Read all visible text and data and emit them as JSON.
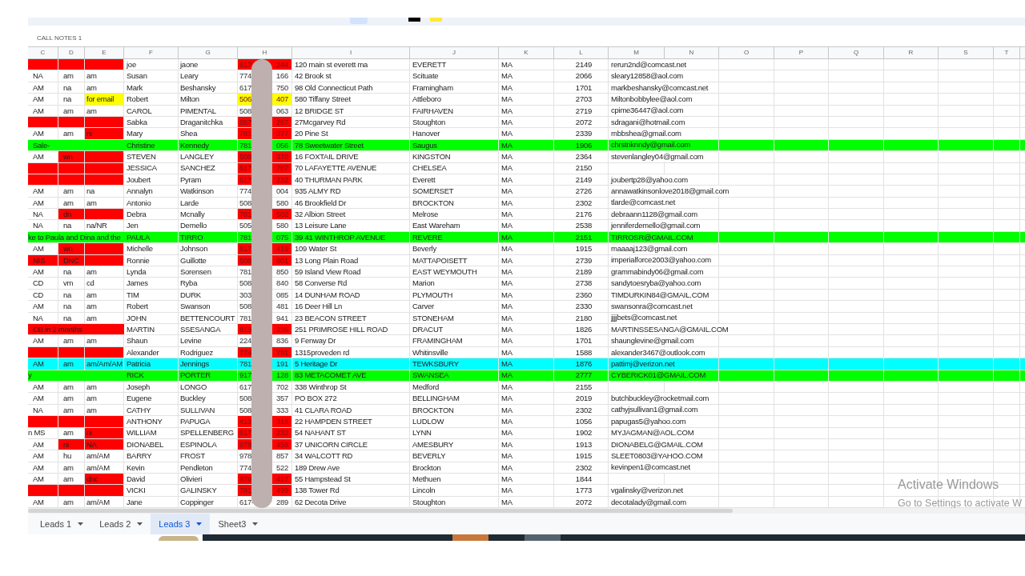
{
  "formula_bar": {
    "cell_text": "CALL NOTES 1"
  },
  "toolbar": {
    "swatches": [
      {
        "color": "#000000"
      },
      {
        "color": "#ffe83a"
      }
    ]
  },
  "columns": [
    "C",
    "D",
    "E",
    "F",
    "G",
    "H",
    "I",
    "J",
    "K",
    "L",
    "M",
    "N",
    "O",
    "P",
    "Q",
    "R",
    "S",
    "T"
  ],
  "rows": [
    {
      "notes": [
        {
          "color": "#ff0000"
        },
        {
          "color": "#ff0000"
        },
        {
          "color": "#ff0000"
        }
      ],
      "first": "joe",
      "last": "jaone",
      "phone": {
        "start": "617",
        "end": "244",
        "color": "#ff0000"
      },
      "address": "120 main st everett ma",
      "city": "EVERETT",
      "state": "MA",
      "zip": "2149",
      "email": "rerun2nd@comcast.net"
    },
    {
      "notes": [
        {
          "text": "NA"
        },
        {
          "text": "am"
        },
        {
          "text": "am"
        }
      ],
      "first": "Susan",
      "last": "Leary",
      "phone": {
        "start": "774",
        "end": "166"
      },
      "address": "42 Brook st",
      "city": "Scituate",
      "state": "MA",
      "zip": "2066",
      "email": "sleary12858@aol.com"
    },
    {
      "notes": [
        {
          "text": "AM"
        },
        {
          "text": "na"
        },
        {
          "text": "am"
        }
      ],
      "first": "Mark",
      "last": "Beshansky",
      "phone": {
        "start": "617",
        "end": "750"
      },
      "address": "98 Old Connecticut Path",
      "city": "Framingham",
      "state": "MA",
      "zip": "1701",
      "email": "markbeshansky@comcast.net"
    },
    {
      "notes": [
        {
          "text": "AM"
        },
        {
          "text": "na"
        },
        {
          "text": "for email",
          "color": "#ffff00"
        }
      ],
      "first": "Robert",
      "last": "Milton",
      "phone": {
        "start": "506",
        "end": "407",
        "color": "#ffff00"
      },
      "address": "580 Tiffany Street",
      "city": "Attleboro",
      "state": "MA",
      "zip": "2703",
      "email": "Miltonbobbylee@aol.com"
    },
    {
      "notes": [
        {
          "text": "AM"
        },
        {
          "text": "am"
        },
        {
          "text": "am"
        }
      ],
      "first": "CAROL",
      "last": "PIMENTAL",
      "phone": {
        "start": "508",
        "end": "063"
      },
      "address": "12 BRIDGE ST",
      "city": "FAIRHAVEN",
      "state": "MA",
      "zip": "2719",
      "email": "cpime36447@aol.com"
    },
    {
      "notes": [
        {
          "color": "#ff0000"
        },
        {
          "color": "#ff0000"
        },
        {
          "color": "#ff0000"
        }
      ],
      "first": "Sabka",
      "last": "Draganitchka",
      "phone": {
        "start": "857",
        "end": "267",
        "color": "#ff0000"
      },
      "address": "27Mcgarvey Rd",
      "city": "Stoughton",
      "state": "MA",
      "zip": "2072",
      "email": "sdragani@hotmail.com"
    },
    {
      "notes": [
        {
          "text": "AM"
        },
        {
          "text": "am"
        },
        {
          "text": "ni",
          "color": "#ff0000"
        }
      ],
      "first": "Mary",
      "last": "Shea",
      "phone": {
        "start": "781",
        "end": "377",
        "color": "#ff0000"
      },
      "address": "20 Pine St",
      "city": "Hanover",
      "state": "MA",
      "zip": "2339",
      "email": "mbbshea@gmail.com"
    },
    {
      "color": "#00ff00",
      "merged_note": {
        "text": "Sale-"
      },
      "first": "Christine",
      "last": "Kennedy",
      "phone": {
        "start": "781",
        "end": "056"
      },
      "address": "78 Sweetwater Street",
      "city": "Saugus",
      "state": "MA",
      "zip": "1906",
      "email": "chrstnknndy@gmail.com"
    },
    {
      "notes": [
        {
          "text": "AM"
        },
        {
          "text": "wn",
          "color": "#ff0000"
        },
        {
          "color": "#ff0000"
        }
      ],
      "first": "STEVEN",
      "last": "LANGLEY",
      "phone": {
        "start": "508",
        "end": "370",
        "color": "#ff0000"
      },
      "address": "16 FOXTAIL DRIVE",
      "city": "KINGSTON",
      "state": "MA",
      "zip": "2364",
      "email": "stevenlangley04@gmail.com"
    },
    {
      "notes": [
        {
          "color": "#ff0000"
        },
        {
          "color": "#ff0000"
        },
        {
          "color": "#ff0000"
        }
      ],
      "first": "JESSICA",
      "last": "SANCHEZ",
      "phone": {
        "start": "617",
        "end": "787",
        "color": "#ff0000"
      },
      "address": "70 LAFAYETTE AVENUE",
      "city": "CHELSEA",
      "state": "MA",
      "zip": "2150"
    },
    {
      "notes": [
        {
          "color": "#ff0000"
        },
        {
          "color": "#ff0000"
        },
        {
          "color": "#ff0000"
        }
      ],
      "first": "Joubert",
      "last": "Pyram",
      "phone": {
        "start": "617",
        "end": "232",
        "color": "#ff0000"
      },
      "address": "40 THURMAN PARK",
      "city": "Everett",
      "state": "MA",
      "zip": "2149",
      "email": "joubertp28@yahoo.com"
    },
    {
      "notes": [
        {
          "text": "AM"
        },
        {
          "text": "am"
        },
        {
          "text": "na"
        }
      ],
      "first": "Annalyn",
      "last": "Watkinson",
      "phone": {
        "start": "774",
        "end": "004"
      },
      "address": "935 ALMY RD",
      "city": "SOMERSET",
      "state": "MA",
      "zip": "2726",
      "email": "annawatkinsonlove2018@gmail.com"
    },
    {
      "notes": [
        {
          "text": "AM"
        },
        {
          "text": "am"
        },
        {
          "text": "am"
        }
      ],
      "first": "Antonio",
      "last": "Larde",
      "phone": {
        "start": "508",
        "end": "580"
      },
      "address": "46 Brookfield Dr",
      "city": "BROCKTON",
      "state": "MA",
      "zip": "2302",
      "email": "tlarde@comcast.net"
    },
    {
      "notes": [
        {
          "text": "NA"
        },
        {
          "text": "dn",
          "color": "#ff0000"
        },
        {
          "color": "#ff0000"
        }
      ],
      "first": "Debra",
      "last": "Mcnally",
      "phone": {
        "start": "781",
        "end": "502",
        "color": "#ff0000"
      },
      "address": "32 Albion Street",
      "city": "Melrose",
      "state": "MA",
      "zip": "2176",
      "email": "debraann1128@gmail.com"
    },
    {
      "notes": [
        {
          "text": "NA"
        },
        {
          "text": "na"
        },
        {
          "text": "na/NR"
        }
      ],
      "first": "Jen",
      "last": "Demello",
      "phone": {
        "start": "505",
        "end": "580"
      },
      "address": "13 Leisure Lane",
      "city": "East Wareham",
      "state": "MA",
      "zip": "2538",
      "email": "jenniferdemello@gmail.com"
    },
    {
      "color": "#00ff00",
      "merged_note": {
        "text": "ke to Paula and Dina and the",
        "cut": true
      },
      "first": "PAULA",
      "last": "TIRRO",
      "phone": {
        "start": "781",
        "end": "075"
      },
      "address": "39  41 WINTHROP AVENUE",
      "city": "REVERE",
      "state": "MA",
      "zip": "2151",
      "email": "TIRROSR@GMAIL.COM"
    },
    {
      "notes": [
        {
          "text": "AM"
        },
        {
          "text": "wn",
          "color": "#ff0000"
        },
        {
          "color": "#ff0000"
        }
      ],
      "first": "Michelle",
      "last": "Johnson",
      "phone": {
        "start": "617",
        "end": "419",
        "color": "#ff0000"
      },
      "address": "109 Water St",
      "city": "Beverly",
      "state": "MA",
      "zip": "1915",
      "email": "maaaaj123@gmail.com"
    },
    {
      "notes": [
        {
          "text": "NIS",
          "color": "#ff0000"
        },
        {
          "text": "DNC",
          "color": "#ff0000"
        },
        {
          "color": "#ff0000"
        }
      ],
      "first": "Ronnie",
      "last": "Guillotte",
      "phone": {
        "start": "508",
        "end": "901",
        "color": "#ff0000"
      },
      "address": "13 Long Plain Road",
      "city": "MATTAPOISETT",
      "state": "MA",
      "zip": "2739",
      "email": "imperialforce2003@yahoo.com"
    },
    {
      "notes": [
        {
          "text": "AM"
        },
        {
          "text": "na"
        },
        {
          "text": "am"
        }
      ],
      "first": "Lynda",
      "last": "Sorensen",
      "phone": {
        "start": "781",
        "end": "850"
      },
      "address": "59 Island View Road",
      "city": "EAST WEYMOUTH",
      "state": "MA",
      "zip": "2189",
      "email": "grammabindy06@gmail.com"
    },
    {
      "notes": [
        {
          "text": "CD"
        },
        {
          "text": "vm"
        },
        {
          "text": "cd"
        }
      ],
      "first": "James",
      "last": "Ryba",
      "phone": {
        "start": "508",
        "end": "840"
      },
      "address": "58 Converse Rd",
      "city": "Marion",
      "state": "MA",
      "zip": "2738",
      "email": "sandytoesryba@yahoo.com"
    },
    {
      "notes": [
        {
          "text": "CD"
        },
        {
          "text": "na"
        },
        {
          "text": "am"
        }
      ],
      "first": "TIM",
      "last": "DURK",
      "phone": {
        "start": "303",
        "end": "085"
      },
      "address": "14 DUNHAM ROAD",
      "city": "PLYMOUTH",
      "state": "MA",
      "zip": "2360",
      "email": "TIMDURKIN84@GMAIL.COM"
    },
    {
      "notes": [
        {
          "text": "AM"
        },
        {
          "text": "na"
        },
        {
          "text": "am"
        }
      ],
      "first": "Robert",
      "last": "Swanson",
      "phone": {
        "start": "508",
        "end": "481"
      },
      "address": "16 Deer Hill Ln",
      "city": "Carver",
      "state": "MA",
      "zip": "2330",
      "email": "swansonra@comcast.net"
    },
    {
      "notes": [
        {
          "text": "NA"
        },
        {
          "text": "na"
        },
        {
          "text": "am"
        }
      ],
      "first": "JOHN",
      "last": "BETTENCOURT",
      "phone": {
        "start": "781",
        "end": "941"
      },
      "address": "23 BEACON STREET",
      "city": "STONEHAM",
      "state": "MA",
      "zip": "2180",
      "email": "jjjjbets@comcast.net"
    },
    {
      "merged_note": {
        "text": "CB in 2 months",
        "color": "#ff0000"
      },
      "first": "MARTIN",
      "last": "SSESANGA",
      "phone": {
        "start": "813",
        "end": "235",
        "color": "#ff0000"
      },
      "address": "251 PRIMROSE HILL ROAD",
      "city": "DRACUT",
      "state": "MA",
      "zip": "1826",
      "email": "MARTINSSESANGA@GMAIL.COM"
    },
    {
      "notes": [
        {
          "text": "AM"
        },
        {
          "text": "am"
        },
        {
          "text": "am"
        }
      ],
      "first": "Shaun",
      "last": "Levine",
      "phone": {
        "start": "224",
        "end": "836"
      },
      "address": "9 Fenway Dr",
      "city": "FRAMINGHAM",
      "state": "MA",
      "zip": "1701",
      "email": "shaunglevine@gmail.com"
    },
    {
      "notes": [
        {
          "color": "#ff0000"
        },
        {
          "color": "#ff0000"
        },
        {
          "color": "#ff0000"
        }
      ],
      "first": "Alexander",
      "last": "Rodriguez",
      "phone": {
        "start": "774",
        "end": "791",
        "color": "#ff0000"
      },
      "address": "1315proveden rd",
      "city": "Whitinsville",
      "state": "MA",
      "zip": "1588",
      "email": "alexander3467@outlook.com"
    },
    {
      "color": "#00ffff",
      "notes": [
        {
          "text": "AM"
        },
        {
          "text": "am"
        },
        {
          "text": "am/Am/AM"
        }
      ],
      "first": "Patricia",
      "last": "Jennings",
      "phone": {
        "start": "781",
        "end": "191"
      },
      "address": "5 Heritage Dr",
      "city": "TEWKSBURY",
      "state": "MA",
      "zip": "1876",
      "email": "pattimj@verizon.net"
    },
    {
      "color": "#00ff00",
      "merged_note": {
        "text": "y",
        "cut": true
      },
      "first": "RICK",
      "last": "PORTER",
      "phone": {
        "start": "917",
        "end": "128"
      },
      "address": "83 METACOMET AVE",
      "city": "SWANSEA",
      "state": "MA",
      "zip": "2777",
      "email": "CYBERICK01@GMAIL.COM"
    },
    {
      "notes": [
        {
          "text": "AM"
        },
        {
          "text": "am"
        },
        {
          "text": "am"
        }
      ],
      "first": "Joseph",
      "last": "LONGO",
      "phone": {
        "start": "617",
        "end": "702"
      },
      "address": "338 Winthrop St",
      "city": "Medford",
      "state": "MA",
      "zip": "2155"
    },
    {
      "notes": [
        {
          "text": "AM"
        },
        {
          "text": "am"
        },
        {
          "text": "am"
        }
      ],
      "first": "Eugene",
      "last": "Buckley",
      "phone": {
        "start": "508",
        "end": "357"
      },
      "address": "PO BOX 272",
      "city": "BELLINGHAM",
      "state": "MA",
      "zip": "2019",
      "email": "butchbuckley@rocketmail.com"
    },
    {
      "notes": [
        {
          "text": "NA"
        },
        {
          "text": "am"
        },
        {
          "text": "am"
        }
      ],
      "first": "CATHY",
      "last": "SULLIVAN",
      "phone": {
        "start": "508",
        "end": "333"
      },
      "address": "41 CLARA ROAD",
      "city": "BROCKTON",
      "state": "MA",
      "zip": "2302",
      "email": "cathyjsullivan1@gmail.com"
    },
    {
      "notes": [
        {
          "color": "#ff0000"
        },
        {
          "color": "#ff0000"
        },
        {
          "color": "#ff0000"
        }
      ],
      "first": "ANTHONY",
      "last": "PAPUGA",
      "phone": {
        "start": "413",
        "end": "316",
        "color": "#ff0000"
      },
      "address": "22 HAMPDEN STREET",
      "city": "LUDLOW",
      "state": "MA",
      "zip": "1056",
      "email": "papugas5@yahoo.com"
    },
    {
      "notes": [
        {
          "text": "n MS",
          "cut": true
        },
        {
          "text": "am"
        },
        {
          "text": "ni",
          "color": "#ff0000"
        }
      ],
      "first": "WILLIAM",
      "last": "SPELLENBERG",
      "phone": {
        "start": "617",
        "end": "232",
        "color": "#ff0000"
      },
      "address": "54 NAHANT ST",
      "city": "LYNN",
      "state": "MA",
      "zip": "1902",
      "email": "MYJAGMAN@AOL.COM"
    },
    {
      "notes": [
        {
          "text": "AM"
        },
        {
          "text": "ni",
          "color": "#ff0000"
        },
        {
          "text": "NA",
          "color": "#ff0000"
        }
      ],
      "first": "DIONABEL",
      "last": "ESPINOLA",
      "phone": {
        "start": "978",
        "end": "458",
        "color": "#ff0000"
      },
      "address": "37 UNICORN CIRCLE",
      "city": "AMESBURY",
      "state": "MA",
      "zip": "1913",
      "email": "DIONABELG@GMAIL.COM"
    },
    {
      "notes": [
        {
          "text": "AM"
        },
        {
          "text": "hu"
        },
        {
          "text": "am/AM"
        }
      ],
      "first": "BARRY",
      "last": "FROST",
      "phone": {
        "start": "978",
        "end": "857"
      },
      "address": "34 WALCOTT RD",
      "city": "BEVERLY",
      "state": "MA",
      "zip": "1915",
      "email": "SLEET0803@YAHOO.COM"
    },
    {
      "notes": [
        {
          "text": "AM"
        },
        {
          "text": "am"
        },
        {
          "text": "am/AM"
        }
      ],
      "first": "Kevin",
      "last": "Pendleton",
      "phone": {
        "start": "774",
        "end": "522"
      },
      "address": "189 Drew Ave",
      "city": "Brockton",
      "state": "MA",
      "zip": "2302",
      "email": "kevinpen1@comcast.net"
    },
    {
      "notes": [
        {
          "text": "AM"
        },
        {
          "text": "am"
        },
        {
          "text": "dnc",
          "color": "#ff0000"
        }
      ],
      "first": "David",
      "last": "Olivieri",
      "phone": {
        "start": "978",
        "end": "427",
        "color": "#ff0000"
      },
      "address": "55 Hampstead St",
      "city": "Methuen",
      "state": "MA",
      "zip": "1844"
    },
    {
      "notes": [
        {
          "color": "#ff0000"
        },
        {
          "color": "#ff0000"
        },
        {
          "color": "#ff0000"
        }
      ],
      "first": "VICKI",
      "last": "GALINSKY",
      "phone": {
        "start": "781",
        "end": "499",
        "color": "#ff0000"
      },
      "address": "138 Tower Rd",
      "city": "Lincoln",
      "state": "MA",
      "zip": "1773",
      "email": "vgalinsky@verizon.net"
    },
    {
      "notes": [
        {
          "text": "AM"
        },
        {
          "text": "am"
        },
        {
          "text": "am/AM"
        }
      ],
      "first": "Jane",
      "last": "Coppinger",
      "phone": {
        "start": "617-",
        "end": "289"
      },
      "address": "62 Decota Drive",
      "city": "Stoughton",
      "state": "MA",
      "zip": "2072",
      "email": "decotalady@gmail.com"
    }
  ],
  "sheet_tabs": [
    {
      "label": "Leads 1",
      "selected": false
    },
    {
      "label": "Leads 2",
      "selected": false
    },
    {
      "label": "Leads 3",
      "selected": true
    },
    {
      "label": "Sheet3",
      "selected": false
    }
  ],
  "windows_notice": {
    "title": "Activate Windows",
    "subtitle": "Go to Settings to activate W"
  }
}
